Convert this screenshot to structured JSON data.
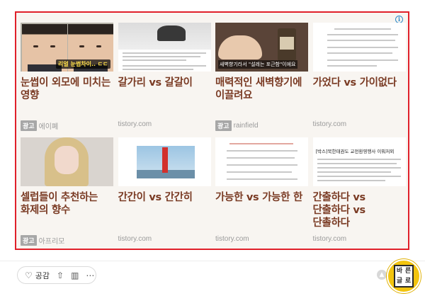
{
  "ad": {
    "info_glyph": "i",
    "cards": [
      {
        "title": "눈썹이 외모에 미치는 영향",
        "badge": "광고",
        "source": "에이폐",
        "thumb_caption": "리얼 눈썹차이.. ㄷㄷ"
      },
      {
        "title": "갈가리 vs 갈갈이",
        "badge": "",
        "source": "tistory.com",
        "thumb_caption": ""
      },
      {
        "title": "매력적인 새벽향기에 이끌려요",
        "badge": "광고",
        "source": "rainfield",
        "thumb_caption": "새벽향기라서 \"설레는 포근함\"이에요"
      },
      {
        "title": "가었다 vs 가이없다",
        "badge": "",
        "source": "tistory.com",
        "thumb_caption": ""
      },
      {
        "title": "셀럽들이 추천하는 화제의 향수",
        "badge": "광고",
        "source": "아프리모",
        "thumb_caption": ""
      },
      {
        "title": "간간이 vs 간간히",
        "badge": "",
        "source": "tistory.com",
        "thumb_caption": ""
      },
      {
        "title": "가능한 vs 가능한 한",
        "badge": "",
        "source": "tistory.com",
        "thumb_caption": ""
      },
      {
        "title": "간출하다 vs 단출하다 vs 단촐하다",
        "badge": "",
        "source": "tistory.com",
        "thumb_caption": "[박스]북한태권도 교전환영행사 이뭐저뫼"
      }
    ]
  },
  "actions": {
    "like_label": "공감",
    "share_icon": "share-icon",
    "stats_icon": "stats-icon",
    "more_icon": "more-icon"
  },
  "badge": {
    "chars": [
      "바",
      "른",
      "글",
      "로"
    ]
  },
  "colors": {
    "frame": "#e0202a",
    "title": "#7a3b24",
    "badge_bg": "#f2c40f"
  }
}
